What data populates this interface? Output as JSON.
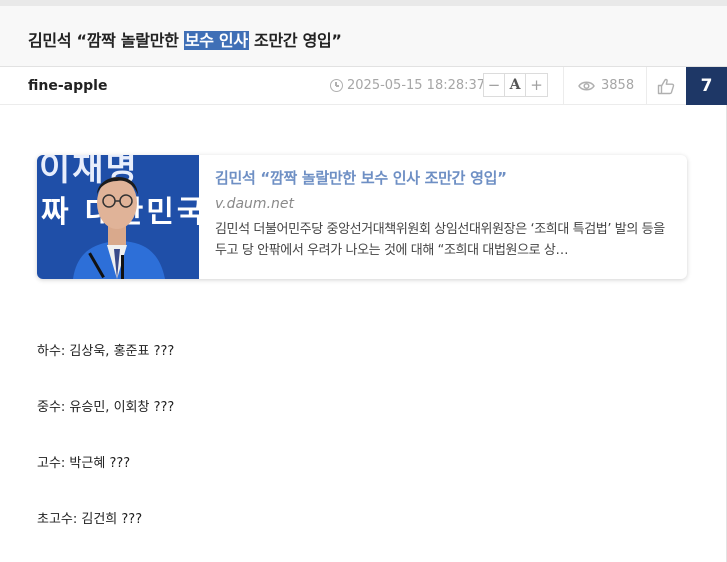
{
  "post": {
    "title_pre": "김민석 “깜짝 놀랄만한 ",
    "title_highlight": "보수 인사",
    "title_post": " 조만간 영입”",
    "author": "fine-apple",
    "datetime": "2025-05-15 18:28:37",
    "font_controls": {
      "decrease": "−",
      "reset": "A",
      "increase": "+"
    },
    "views": "3858",
    "score": "7"
  },
  "link_card": {
    "thumbnail_text_top": "이재명",
    "thumbnail_text_bottom": "짜 대한민국",
    "title": "김민석 “깜짝 놀랄만한 보수 인사 조만간 영입”",
    "domain": "v.daum.net",
    "description": "김민석 더불어민주당 중앙선거대책위원회 상임선대위원장은 ‘조희대 특검법’ 발의 등을 두고 당 안팎에서 우려가 나오는 것에 대해 “조희대 대법원으로 상…"
  },
  "body": {
    "lines": [
      "하수: 김상욱, 홍준표 ???",
      "중수: 유승민, 이회창 ???",
      "고수: 박근혜 ???",
      "초고수: 김건희 ???"
    ]
  },
  "colors": {
    "highlight": "#3f6fb6",
    "score_bg": "#1e3766",
    "card_title": "#6e8fc4"
  }
}
